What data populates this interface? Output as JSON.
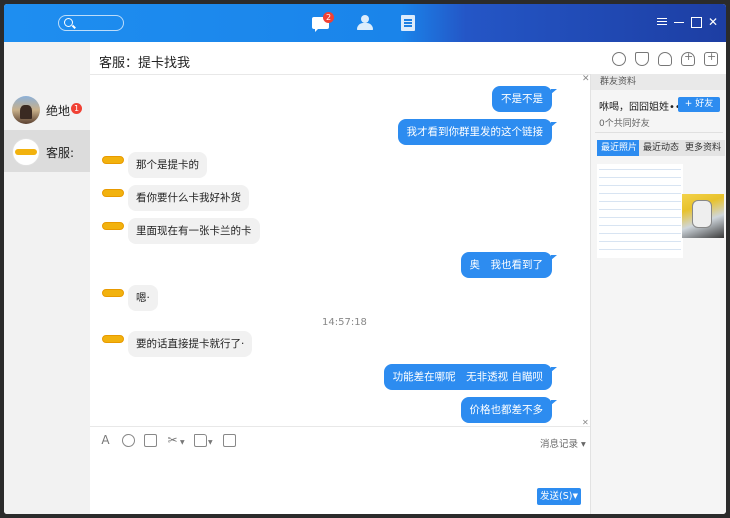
{
  "topbar": {
    "chat_badge": "2"
  },
  "sidebar": {
    "conversations": [
      {
        "name": "绝地",
        "unread": "1"
      },
      {
        "name": "客服:",
        "unread": ""
      }
    ]
  },
  "chat": {
    "title": "客服：提卡找我",
    "timestamp": "14:57:18",
    "messages_out": [
      "不是不是",
      "我才看到你群里发的这个链接",
      "奥　我也看到了",
      "功能差在哪呢　无非透视 自瞄呗",
      "价格也都差不多"
    ],
    "messages_in": [
      "那个是提卡的",
      "看你要什么卡我好补货",
      "里面现在有一张卡兰的卡",
      "嗯·",
      "要的话直接提卡就行了·"
    ],
    "history_label": "消息记录",
    "send_label": "发送(S)",
    "tool_font": "A",
    "tool_cut": "✂"
  },
  "profile": {
    "header": "群友资料",
    "name": "咻喝，囧囧姐姓••",
    "add_friend": "好友",
    "add_plus": "+",
    "mutual": "0个共同好友",
    "tabs": [
      "最近照片",
      "最近动态",
      "更多资料"
    ]
  },
  "icons": {
    "accent": "#2d8cf0",
    "badge": "#f04134"
  }
}
